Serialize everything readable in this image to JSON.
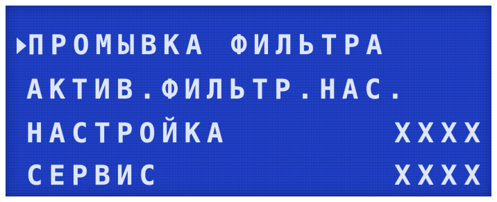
{
  "menu": {
    "items": [
      {
        "label": "ПРОМЫВКА ФИЛЬТРА",
        "value": "",
        "selected": true
      },
      {
        "label": "АКТИВ.ФИЛЬТР.НАС.",
        "value": "",
        "selected": false
      },
      {
        "label": "НАСТРОЙКА",
        "value": "XXXX",
        "selected": false
      },
      {
        "label": "СЕРВИС",
        "value": "XXXX",
        "selected": false
      }
    ],
    "cursor_icon": "triangle-right-icon"
  },
  "colors": {
    "screen_background": "#1f3fc4",
    "text": "#dde6ff"
  }
}
